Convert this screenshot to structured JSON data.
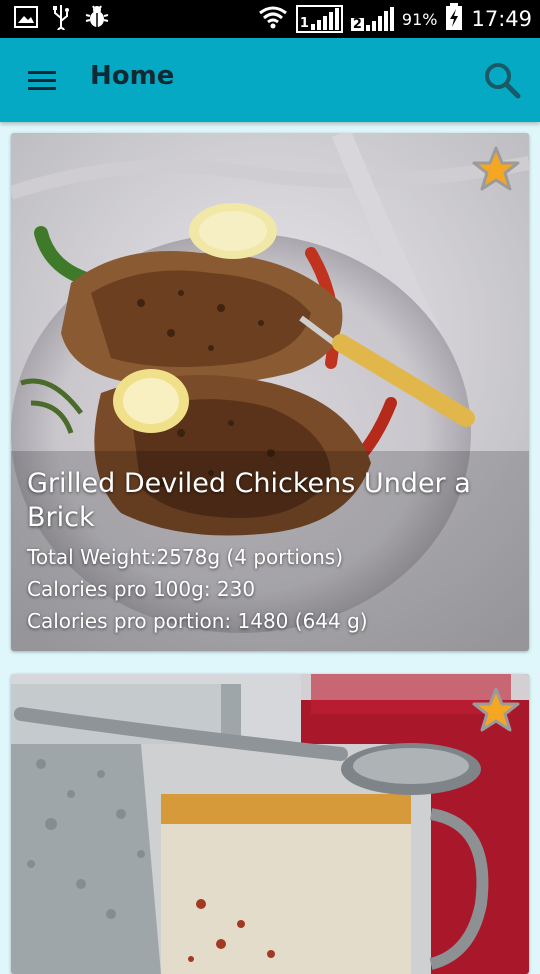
{
  "status_bar": {
    "battery_percent": "91%",
    "time": "17:49",
    "sim1": "1",
    "sim2": "2",
    "icons": [
      "image-icon",
      "usb-icon",
      "bug-icon",
      "wifi-icon",
      "signal-icon",
      "battery-charging-icon"
    ]
  },
  "app_bar": {
    "title": "Home",
    "color": "#06a9c3",
    "menu_icon": "hamburger-menu-icon",
    "search_icon": "search-icon"
  },
  "recipes": [
    {
      "title": "Grilled Deviled Chickens Under a Brick",
      "total_weight": "Total Weight:2578g (4 portions)",
      "calories_100g": "Calories pro 100g: 230",
      "calories_portion": "Calories pro portion: 1480 (644 g)",
      "favorite": true,
      "image": "grilled chicken on plate with lemon"
    },
    {
      "title": "",
      "favorite": true,
      "image": "glass mug with spiced drink and spoon"
    }
  ],
  "colors": {
    "accent": "#06a9c3",
    "background": "#dff7fa",
    "star": "#f5a623"
  }
}
